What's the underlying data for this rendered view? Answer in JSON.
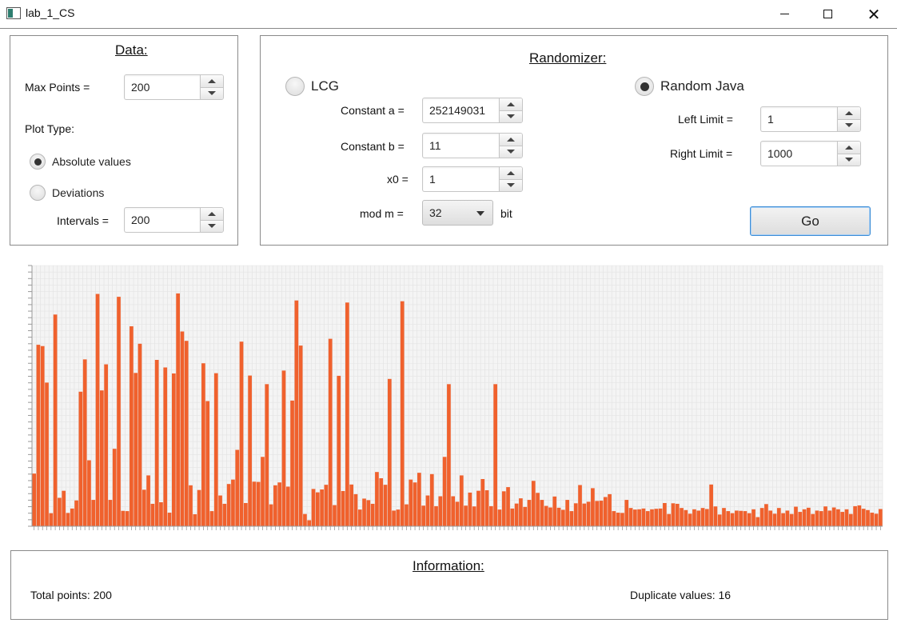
{
  "window": {
    "title": "lab_1_CS"
  },
  "data_panel": {
    "title": "Data:",
    "max_points_label": "Max Points =",
    "max_points_value": "200",
    "plot_type_label": "Plot Type:",
    "plot_options": [
      {
        "label": "Absolute values",
        "selected": true
      },
      {
        "label": "Deviations",
        "selected": false
      }
    ],
    "intervals_label": "Intervals =",
    "intervals_value": "200"
  },
  "randomizer_panel": {
    "title": "Randomizer:",
    "lcg": {
      "label": "LCG",
      "selected": false,
      "constant_a_label": "Constant a =",
      "constant_a_value": "252149031",
      "constant_b_label": "Constant b =",
      "constant_b_value": "11",
      "x0_label": "x0 =",
      "x0_value": "1",
      "mod_label": "mod m =",
      "mod_value": "32",
      "mod_unit": "bit"
    },
    "java": {
      "label": "Random Java",
      "selected": true,
      "left_limit_label": "Left Limit =",
      "left_limit_value": "1",
      "right_limit_label": "Right Limit =",
      "right_limit_value": "1000"
    },
    "go_label": "Go"
  },
  "info_panel": {
    "title": "Information:",
    "total_points": "Total points: 200",
    "duplicate_values": "Duplicate values: 16"
  },
  "chart_data": {
    "type": "bar",
    "bar_color": "#f0612d",
    "ylim": [
      0,
      1000
    ],
    "grid": true,
    "values": [
      202,
      696,
      691,
      551,
      50,
      812,
      109,
      136,
      51,
      68,
      99,
      516,
      640,
      253,
      101,
      891,
      521,
      621,
      101,
      297,
      880,
      59,
      58,
      767,
      588,
      700,
      140,
      195,
      86,
      638,
      92,
      609,
      52,
      586,
      893,
      747,
      711,
      157,
      46,
      139,
      625,
      480,
      58,
      587,
      118,
      86,
      162,
      179,
      293,
      708,
      89,
      578,
      171,
      170,
      266,
      545,
      84,
      157,
      168,
      597,
      152,
      482,
      866,
      693,
      47,
      23,
      143,
      130,
      141,
      159,
      719,
      81,
      577,
      135,
      858,
      160,
      123,
      64,
      106,
      100,
      86,
      208,
      184,
      159,
      565,
      60,
      64,
      863,
      84,
      179,
      168,
      205,
      79,
      118,
      200,
      77,
      115,
      266,
      545,
      115,
      94,
      195,
      79,
      129,
      76,
      136,
      181,
      138,
      77,
      545,
      64,
      134,
      150,
      68,
      87,
      107,
      74,
      101,
      174,
      128,
      101,
      78,
      72,
      114,
      71,
      63,
      101,
      58,
      88,
      158,
      87,
      94,
      146,
      97,
      98,
      112,
      123,
      58,
      52,
      51,
      101,
      70,
      64,
      65,
      68,
      58,
      65,
      67,
      68,
      89,
      47,
      88,
      86,
      70,
      62,
      48,
      65,
      60,
      70,
      66,
      160,
      76,
      45,
      70,
      58,
      50,
      60,
      59,
      58,
      50,
      65,
      35,
      70,
      85,
      60,
      48,
      70,
      50,
      60,
      47,
      75,
      55,
      65,
      71,
      47,
      60,
      58,
      76,
      60,
      72,
      65,
      55,
      65,
      47,
      77,
      80,
      67,
      62,
      52,
      48,
      66
    ]
  }
}
